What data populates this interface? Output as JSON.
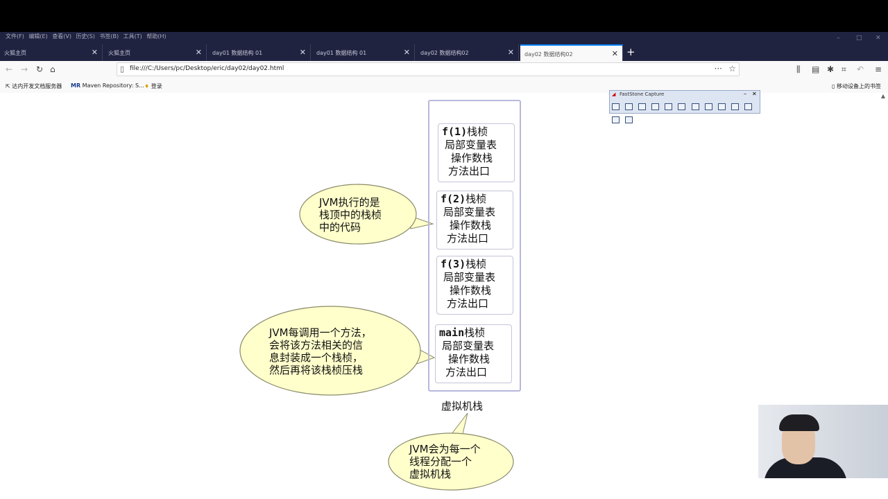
{
  "browser": {
    "menu": [
      "文件(F)",
      "编辑(E)",
      "查看(V)",
      "历史(S)",
      "书签(B)",
      "工具(T)",
      "帮助(H)"
    ],
    "tabs": [
      {
        "label": "火狐主页"
      },
      {
        "label": "火狐主页"
      },
      {
        "label": "day01 数据结构 01"
      },
      {
        "label": "day01 数据结构 01"
      },
      {
        "label": "day02 数据结构02"
      },
      {
        "label": "day02 数据结构02"
      }
    ],
    "active_tab": 5,
    "url": "file:///C:/Users/pc/Desktop/eric/day02/day02.html",
    "bookmarks": [
      "达内开发文档服务器",
      "Maven Repository: S...",
      "登录"
    ],
    "mobile_bookmarks": "移动设备上的书签",
    "accent": "#0a84ff"
  },
  "fastcapture": {
    "title": "FastStone Capture"
  },
  "diagram": {
    "frames": [
      {
        "title": "f(1)",
        "suffix": "栈桢",
        "line2": "局部变量表",
        "line3": "操作数栈",
        "line4": "方法出口"
      },
      {
        "title": "f(2)",
        "suffix": "栈桢",
        "line2": "局部变量表",
        "line3": "操作数栈",
        "line4": "方法出口"
      },
      {
        "title": "f(3)",
        "suffix": "栈桢",
        "line2": "局部变量表",
        "line3": "操作数栈",
        "line4": "方法出口"
      },
      {
        "title": "main",
        "suffix": "栈桢",
        "line2": "局部变量表",
        "line3": "操作数栈",
        "line4": "方法出口"
      }
    ],
    "stack_label": "虚拟机栈",
    "bubbles": [
      {
        "lines": [
          "JVM执行的是",
          "栈顶中的栈桢",
          "中的代码"
        ]
      },
      {
        "lines": [
          "JVM每调用一个方法，",
          "会将该方法相关的信",
          "息封装成一个栈桢，",
          "然后再将该栈桢压栈"
        ]
      },
      {
        "lines": [
          "JVM会为每一个",
          "线程分配一个",
          "虚拟机栈"
        ]
      }
    ],
    "bubble_fill": "#ffffcc"
  }
}
